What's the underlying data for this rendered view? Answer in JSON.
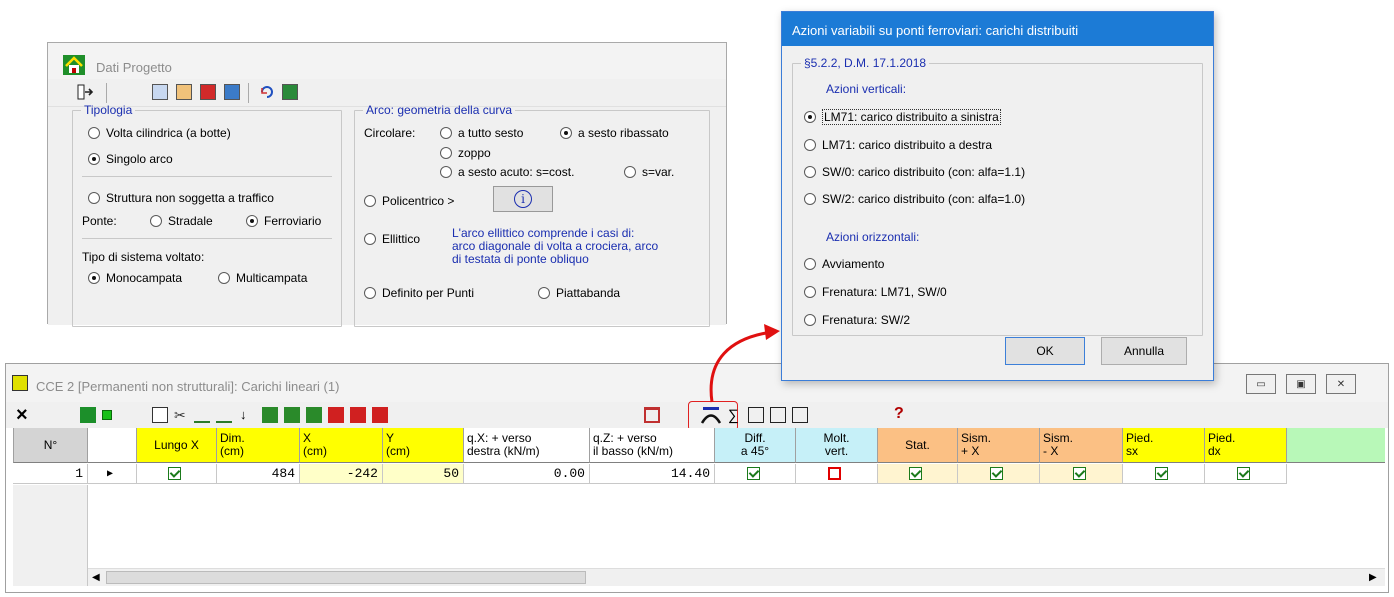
{
  "dati_progetto": {
    "title": "Dati Progetto",
    "tipologia": {
      "legend": "Tipologia",
      "opt_volta": "Volta cilindrica (a botte)",
      "opt_singolo": "Singolo arco",
      "opt_non_traffico": "Struttura non soggetta a traffico",
      "ponte_label": "Ponte:",
      "opt_stradale": "Stradale",
      "opt_ferroviario": "Ferroviario",
      "tipo_sistema_label": "Tipo di sistema voltato:",
      "opt_monocampata": "Monocampata",
      "opt_multicampata": "Multicampata"
    },
    "arco": {
      "legend": "Arco: geometria della curva",
      "circolare_label": "Circolare:",
      "opt_tutto_sesto": "a tutto sesto",
      "opt_sesto_ribassato": "a sesto ribassato",
      "opt_zoppo": "zoppo",
      "opt_sesto_acuto": "a sesto acuto: s=cost.",
      "opt_svar": "s=var.",
      "opt_policentrico": "Policentrico >",
      "info_btn": "i",
      "opt_ellittico": "Ellittico",
      "ellittico_note": [
        "L'arco ellittico comprende i casi di:",
        "arco diagonale di volta a crociera, arco",
        "di testata di ponte obliquo"
      ],
      "opt_definito": "Definito per Punti",
      "opt_piattabanda": "Piattabanda"
    }
  },
  "dialog": {
    "title": "Azioni variabili su ponti ferroviari: carichi distribuiti",
    "group_legend": "§5.2.2, D.M. 17.1.2018",
    "verticali_label": "Azioni verticali:",
    "opt_lm71_sx": "LM71: carico distribuito a sinistra",
    "opt_lm71_dx": "LM71: carico distribuito a destra",
    "opt_sw0": "SW/0: carico distribuito (con: alfa=1.1)",
    "opt_sw2": "SW/2: carico distribuito (con: alfa=1.0)",
    "orizzontali_label": "Azioni orizzontali:",
    "opt_avviamento": "Avviamento",
    "opt_frenatura_lm71": "Frenatura: LM71, SW/0",
    "opt_frenatura_sw2": "Frenatura: SW/2",
    "ok": "OK",
    "annulla": "Annulla"
  },
  "cce": {
    "title": "CCE 2 [Permanenti non strutturali]: Carichi lineari (1)",
    "close_x": "×",
    "help": "?",
    "headers": {
      "n": "N°",
      "lungo_x": "Lungo X",
      "dim": [
        "Dim.",
        "(cm)"
      ],
      "x": [
        "X",
        "(cm)"
      ],
      "y": [
        "Y",
        "(cm)"
      ],
      "qx": [
        "q.X: + verso",
        "destra (kN/m)"
      ],
      "qz": [
        "q.Z: + verso",
        "il basso (kN/m)"
      ],
      "diff": [
        "Diff.",
        "a 45°"
      ],
      "molt": [
        "Molt.",
        "vert."
      ],
      "stat": "Stat.",
      "sism_px": [
        "Sism.",
        "+ X"
      ],
      "sism_mx": [
        "Sism.",
        "- X"
      ],
      "pied_sx": [
        "Pied.",
        "sx"
      ],
      "pied_dx": [
        "Pied.",
        "dx"
      ]
    },
    "row": {
      "n": "1",
      "dim": "484",
      "x": "-242",
      "y": "50",
      "qx": "0.00",
      "qz": "14.40"
    }
  }
}
